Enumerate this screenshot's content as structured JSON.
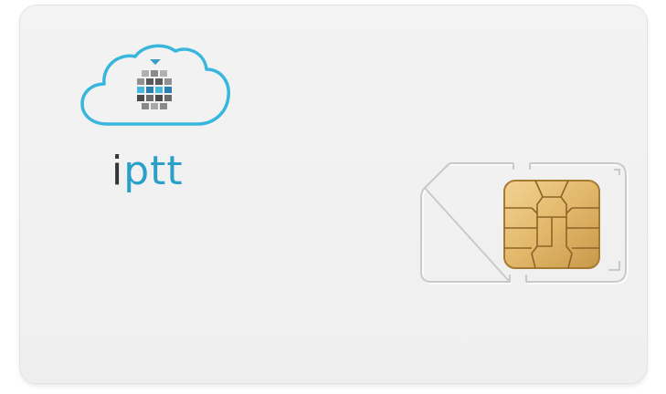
{
  "brand": {
    "name_first": "i",
    "name_rest": "ptt"
  },
  "colors": {
    "card": "#f1f1f1",
    "cloud_outline": "#38b6dc",
    "brand_blue": "#2aa0c8",
    "brand_dark": "#333333",
    "chip_gold": "#e2b86a"
  },
  "icons": {
    "logo": "cloud-icon",
    "chip": "sim-chip-icon"
  }
}
